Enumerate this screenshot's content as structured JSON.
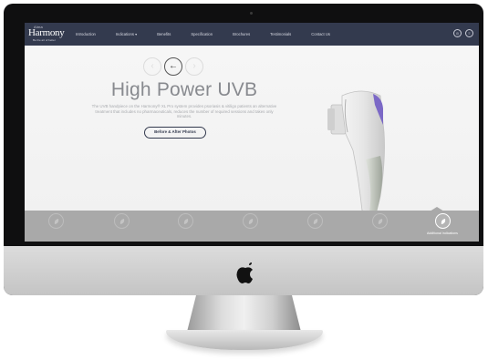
{
  "brand": {
    "top": "Alma",
    "name": "Harmony",
    "tagline": "Be the art of better"
  },
  "nav": {
    "items": [
      "Introduction",
      "Indications ▾",
      "Benefits",
      "Specification",
      "Brochures",
      "Testimonials",
      "Contact Us"
    ]
  },
  "hero": {
    "title": "High Power UVB",
    "description": "The UVB handpiece on the Harmony® XL Pro system provides psoriasis & vitiligo patients an alternative treatment that includes no pharmaceuticals, reduces the number of required sessions and takes only minutes.",
    "cta": "Before & After Photos"
  },
  "indications": {
    "items": [
      {
        "label": ""
      },
      {
        "label": ""
      },
      {
        "label": ""
      },
      {
        "label": ""
      },
      {
        "label": ""
      },
      {
        "label": ""
      },
      {
        "label": "Additional Indications"
      }
    ],
    "active_index": 6
  },
  "colors": {
    "navbar": "#333a4e",
    "accent_purple": "#7b68c6",
    "indications_bar": "#a9a9a9"
  }
}
